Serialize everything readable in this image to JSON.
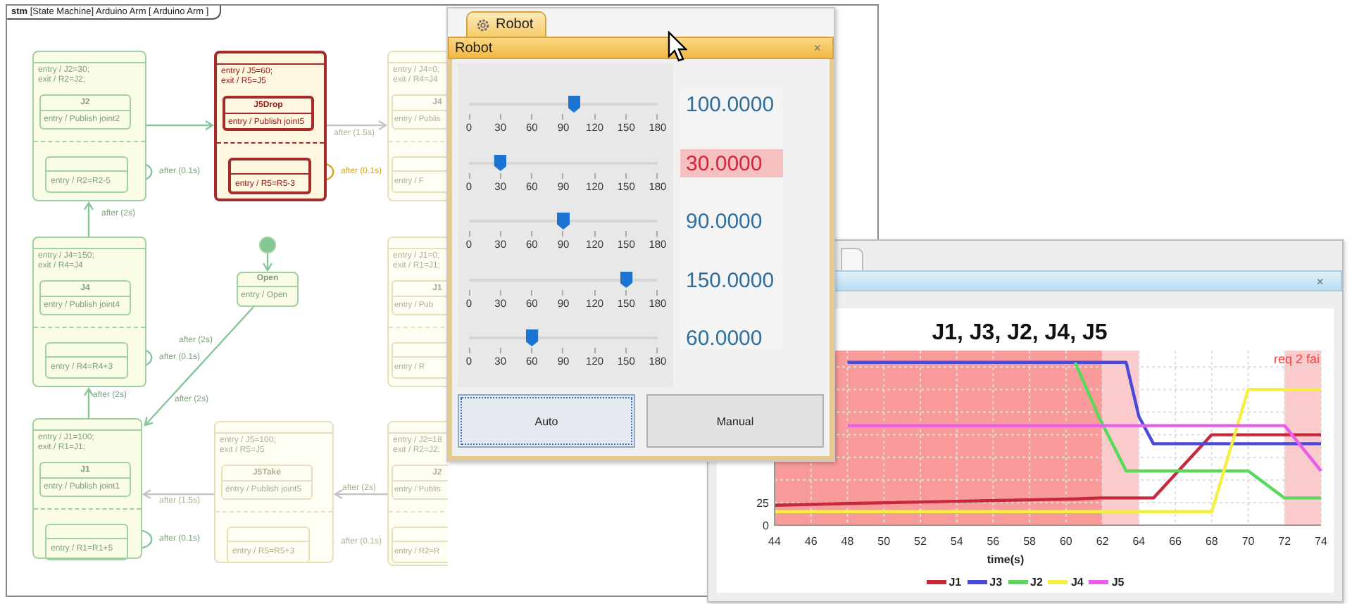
{
  "diagram": {
    "frame_label": "**stm** [State Machine] Arduino Arm [ Arduino Arm ]",
    "states": [
      {
        "kind": "composite",
        "active": false,
        "visited": true,
        "entry": "entry / J2=30;",
        "exit": "exit / R2=J2;",
        "substate": {
          "name": "J2",
          "action": "entry / Publish joint2"
        },
        "loop": {
          "action": "entry / R2=R2-5",
          "label": "after (0.1s)"
        }
      },
      {
        "kind": "composite",
        "active": true,
        "entry": "entry / J5=60;",
        "exit": "exit / R5=J5",
        "substate": {
          "name": "J5Drop",
          "action": "entry / Publish joint5"
        },
        "loop": {
          "action": "entry / R5=R5-3",
          "label": "after (0.1s)"
        }
      },
      {
        "kind": "composite",
        "active": false,
        "visited": false,
        "entry": "entry / J4=0;",
        "exit": "exit / R4=J4",
        "substate": {
          "name": "J4",
          "action": "entry / Publis"
        },
        "loop": {
          "action": "entry / F"
        }
      },
      {
        "kind": "composite",
        "active": false,
        "visited": true,
        "entry": "entry / J4=150;",
        "exit": "exit / R4=J4",
        "substate": {
          "name": "J4",
          "action": "entry / Publish joint4"
        },
        "loop": {
          "action": "entry / R4=R4+3",
          "label": "after (0.1s)"
        }
      },
      {
        "kind": "initial",
        "active": false,
        "visited": true
      },
      {
        "kind": "simple",
        "active": false,
        "visited": true,
        "name": "Open",
        "action": "entry / Open"
      },
      {
        "kind": "composite",
        "active": false,
        "visited": false,
        "entry": "entry / J1=0;",
        "exit": "exit / R1=J1;",
        "substate": {
          "name": "J1",
          "action": "entry / Pub"
        },
        "loop": {
          "action": "entry / R"
        }
      },
      {
        "kind": "composite",
        "active": false,
        "visited": true,
        "entry": "entry / J1=100;",
        "exit": "exit / R1=J1;",
        "substate": {
          "name": "J1",
          "action": "entry / Publish joint1"
        },
        "loop": {
          "action": "entry / R1=R1+5",
          "label": "after (0.1s)"
        }
      },
      {
        "kind": "composite",
        "active": false,
        "visited": false,
        "entry": "entry / J5=100;",
        "exit": "exit / R5=J5",
        "substate": {
          "name": "J5Take",
          "action": "entry / Publish joint5"
        },
        "loop": {
          "action": "entry / R5=R5+3",
          "label": "after (0.1s)"
        }
      },
      {
        "kind": "composite",
        "active": false,
        "visited": false,
        "entry": "entry / J2=18",
        "exit": "exit / R2=J2;",
        "substate": {
          "name": "J2",
          "action": "entry / Publis"
        },
        "loop": {
          "action": "entry / R2=R"
        }
      }
    ],
    "transitions": [
      {
        "visited": true
      },
      {
        "visited": false,
        "label": "after (1.5s)"
      },
      {
        "visited": true,
        "label": "after (2s)"
      },
      {
        "visited": true
      },
      {
        "visited": true,
        "label": "after (2s)"
      },
      {
        "visited": true,
        "label": "after (2s)"
      },
      {
        "visited": false,
        "label": "after (1.5s)"
      },
      {
        "visited": false,
        "label": "after (2s)"
      },
      {
        "visited": true,
        "label": "after (2s)"
      }
    ]
  },
  "robot": {
    "tab": "Robot",
    "title": "Robot",
    "close": "×",
    "sliders": [
      {
        "level": 0.556,
        "ticks": [
          "0",
          "30",
          "60",
          "90",
          "120",
          "150",
          "180"
        ],
        "reading": "100.0000",
        "alert": false
      },
      {
        "level": 0.167,
        "ticks": [
          "0",
          "30",
          "60",
          "90",
          "120",
          "150",
          "180"
        ],
        "reading": "30.0000",
        "alert": true
      },
      {
        "level": 0.5,
        "ticks": [
          "0",
          "30",
          "60",
          "90",
          "120",
          "150",
          "180"
        ],
        "reading": "90.0000",
        "alert": false
      },
      {
        "level": 0.833,
        "ticks": [
          "0",
          "30",
          "60",
          "90",
          "120",
          "150",
          "180"
        ],
        "reading": "150.0000",
        "alert": false
      },
      {
        "level": 0.333,
        "ticks": [
          "0",
          "30",
          "60",
          "90",
          "120",
          "150",
          "180"
        ],
        "reading": "60.0000",
        "alert": false
      }
    ],
    "buttons": [
      {
        "label": "Auto",
        "focused": true
      },
      {
        "label": "Manual",
        "focused": false
      }
    ]
  },
  "plot_window": {
    "close": "×",
    "chart_data": {
      "type": "line",
      "title": "J1, J3, J2, J4, J5",
      "xlabel": "time(s)",
      "x": [
        44,
        48,
        60.5,
        61.8,
        63.3,
        64,
        64.8,
        68,
        70,
        72,
        74
      ],
      "series": [
        {
          "name": "J1",
          "color": "#c8283c",
          "values": [
            22,
            24,
            29,
            30,
            30,
            30,
            30,
            100,
            100,
            100,
            100
          ]
        },
        {
          "name": "J3",
          "color": "#4a4ad8",
          "values": [
            null,
            180,
            180,
            180,
            180,
            120,
            90,
            90,
            90,
            90,
            90
          ]
        },
        {
          "name": "J2",
          "color": "#5ad85a",
          "values": [
            null,
            null,
            180,
            120,
            60,
            60,
            60,
            60,
            60,
            30,
            30
          ]
        },
        {
          "name": "J4",
          "color": "#f4f040",
          "values": [
            15,
            15,
            15,
            15,
            15,
            15,
            15,
            15,
            150,
            150,
            150
          ]
        },
        {
          "name": "J5",
          "color": "#ec5cec",
          "values": [
            null,
            110,
            110,
            110,
            110,
            110,
            110,
            110,
            110,
            110,
            60
          ]
        }
      ],
      "xlim": [
        44,
        74
      ],
      "ylim": [
        0,
        193
      ],
      "xticks": [
        44,
        46,
        48,
        50,
        52,
        54,
        56,
        58,
        60,
        62,
        64,
        66,
        68,
        70,
        72,
        74
      ],
      "yticks": [
        0,
        25
      ],
      "grid": true,
      "legend": "bottom",
      "bands": [
        {
          "axis": "x",
          "from": 44,
          "to": 62,
          "color": "#f99b9b"
        },
        {
          "axis": "x",
          "from": 62,
          "to": 64,
          "color": "#fbcaca"
        },
        {
          "axis": "x",
          "from": 72,
          "to": 74,
          "color": "#fbcaca"
        }
      ],
      "annotations": [
        "req 2 fai"
      ]
    }
  }
}
